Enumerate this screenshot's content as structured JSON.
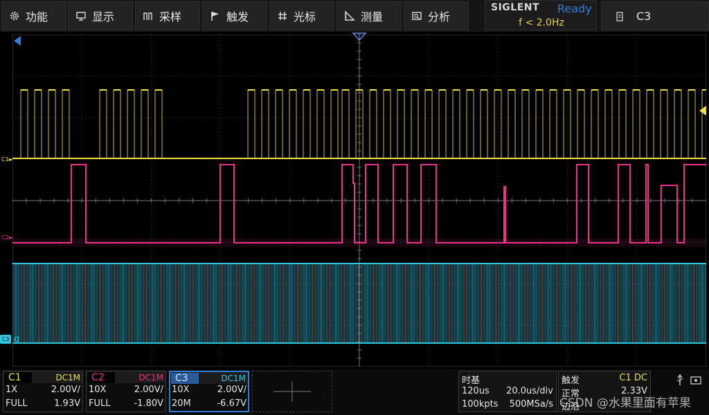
{
  "menu": [
    {
      "label": "功能",
      "icon": "gear-icon"
    },
    {
      "label": "显示",
      "icon": "monitor-icon"
    },
    {
      "label": "采样",
      "icon": "acquire-icon"
    },
    {
      "label": "触发",
      "icon": "flag-icon"
    },
    {
      "label": "光标",
      "icon": "cursor-icon"
    },
    {
      "label": "测量",
      "icon": "ruler-icon"
    },
    {
      "label": "分析",
      "icon": "analyze-icon"
    }
  ],
  "brand": {
    "name": "SIGLENT",
    "status": "Ready",
    "frequency": "f < 2.0Hz"
  },
  "active_channel": "C3",
  "waveform": {
    "c1_label": "C1",
    "c2_label": "C2",
    "c3_label": "C3",
    "c3_ground_label": "g"
  },
  "channels": [
    {
      "name": "C1",
      "coupling": "DC1M",
      "probe": "1X",
      "scale": "2.00V/",
      "bandwidth": "FULL",
      "offset": "1.93V",
      "color": "#f0e040"
    },
    {
      "name": "C2",
      "coupling": "DC1M",
      "probe": "10X",
      "scale": "2.00V/",
      "bandwidth": "FULL",
      "offset": "-1.80V",
      "color": "#f0308c"
    },
    {
      "name": "C3",
      "coupling": "DC1M",
      "probe": "10X",
      "scale": "2.00V/",
      "bandwidth": "20M",
      "offset": "-6.67V",
      "color": "#30c8e0"
    }
  ],
  "timebase": {
    "title": "时基",
    "delay": "120us",
    "scale": "20.0us/div",
    "memory": "100kpts",
    "sample_rate": "500MSa/s"
  },
  "trigger": {
    "title": "触发",
    "source": "C1 DC",
    "mode": "正常",
    "level": "2.33V",
    "edge": "边沿"
  },
  "watermark": "CSDN @水果里面有苹果",
  "colors": {
    "c1": "#f0e040",
    "c2": "#f0308c",
    "c3": "#30c8e0",
    "ready": "#2f7dd8",
    "grid": "#3a3a3a"
  }
}
